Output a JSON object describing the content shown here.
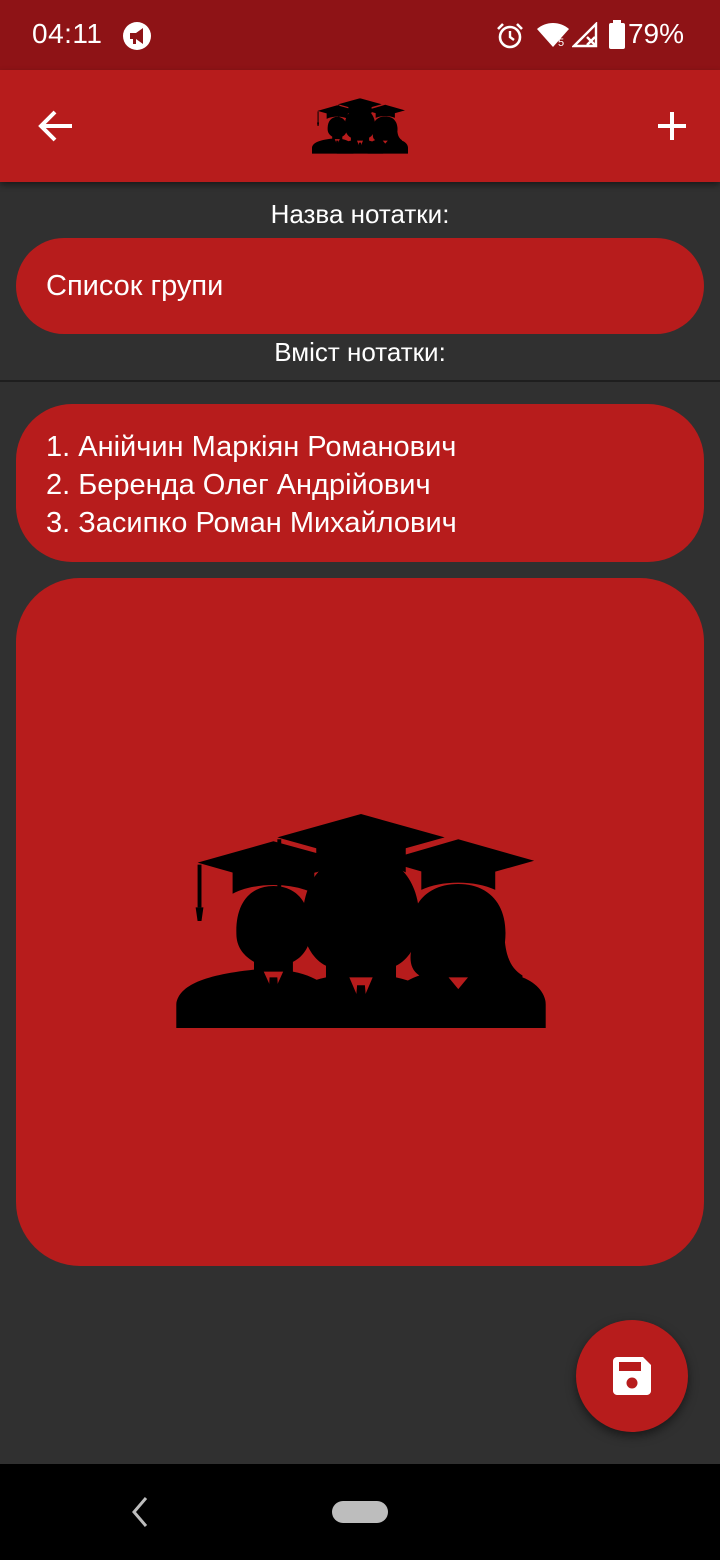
{
  "status_bar": {
    "time": "04:11",
    "battery": "79%",
    "icons": [
      "megaphone-icon",
      "alarm-icon",
      "wifi-icon",
      "signal-icon",
      "battery-icon"
    ]
  },
  "app_bar": {
    "back_icon": "arrow-left-icon",
    "logo_icon": "graduates-icon",
    "add_icon": "plus-icon"
  },
  "form": {
    "title_label": "Назва нотатки:",
    "title_value": "Список групи",
    "content_label": "Вміст нотатки:",
    "content_lines": [
      "1. Анійчин Маркіян Романович",
      "2. Беренда Олег Андрійович",
      "3. Засипко Роман Михайлович"
    ]
  },
  "image": {
    "icon": "graduates-icon"
  },
  "fab": {
    "icon": "save-icon"
  },
  "colors": {
    "accent": "#b71c1c",
    "status_bar": "#8e1316",
    "background": "#303030"
  }
}
